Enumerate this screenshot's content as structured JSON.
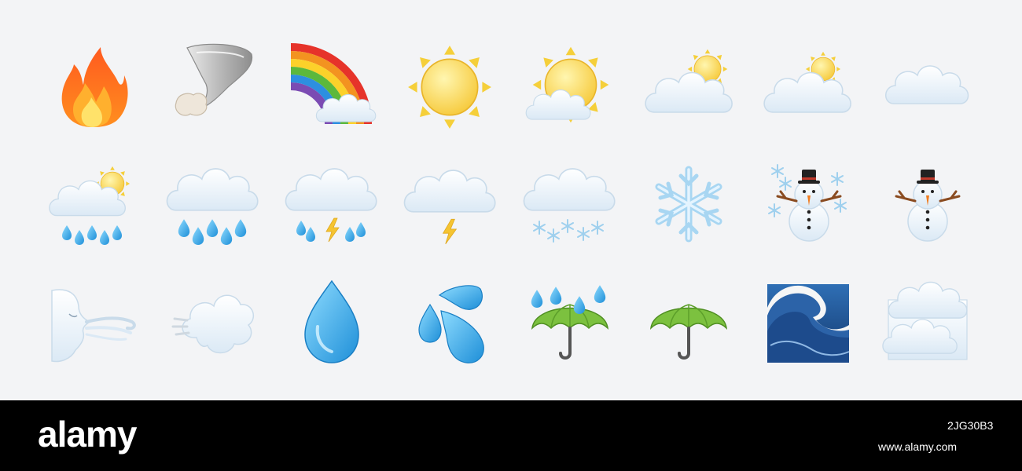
{
  "watermark": {
    "brand": "alamy",
    "image_id": "2JG30B3",
    "site": "www.alamy.com"
  },
  "icons": [
    "fire-icon",
    "tornado-icon",
    "rainbow-icon",
    "sun-icon",
    "sun-behind-small-cloud-icon",
    "sun-behind-cloud-icon",
    "sun-behind-large-cloud-icon",
    "cloud-icon",
    "sun-behind-rain-cloud-icon",
    "cloud-with-rain-icon",
    "cloud-with-lightning-and-rain-icon",
    "cloud-with-lightning-icon",
    "cloud-with-snow-icon",
    "snowflake-icon",
    "snowman-icon",
    "snowman-without-snow-icon",
    "wind-face-icon",
    "dashing-away-icon",
    "droplet-icon",
    "sweat-droplets-icon",
    "umbrella-with-rain-drops-icon",
    "umbrella-icon",
    "water-wave-icon",
    "fog-icon"
  ],
  "colors": {
    "background": "#f3f4f6",
    "footer": "#000000",
    "sun": "#f8d84a",
    "cloud": "#eef6fc",
    "drop": "#3aa6e6",
    "umbrella": "#7cc13f"
  }
}
